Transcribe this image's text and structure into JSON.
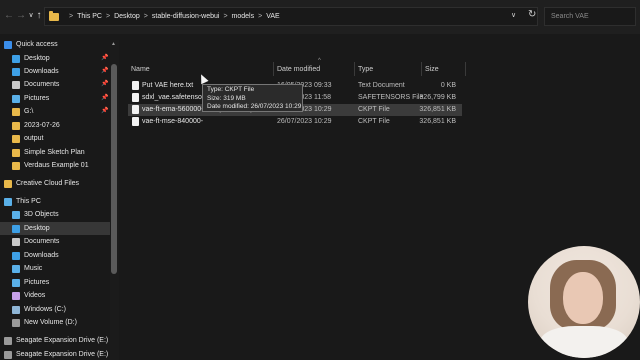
{
  "address_bar": {
    "back": "←",
    "forward": "→",
    "dropdown": "∨",
    "up": "↑",
    "crumbs": [
      "This PC",
      "Desktop",
      "stable-diffusion-webui",
      "models",
      "VAE"
    ],
    "crumb_sep": ">",
    "address_dropdown": "∨",
    "refresh": "↻",
    "search_placeholder": "Search VAE"
  },
  "sidebar": {
    "items": [
      {
        "label": "Quick access",
        "icon": "star-icon",
        "color": "#3b8eea",
        "pinned": false
      },
      {
        "label": "Desktop",
        "icon": "desktop-icon",
        "color": "#3ea0e6",
        "pinned": true
      },
      {
        "label": "Downloads",
        "icon": "download-icon",
        "color": "#3ea0e6",
        "pinned": true
      },
      {
        "label": "Documents",
        "icon": "document-icon",
        "color": "#c9c9c9",
        "pinned": true
      },
      {
        "label": "Pictures",
        "icon": "picture-icon",
        "color": "#5ab0e8",
        "pinned": true
      },
      {
        "label": "G:\\",
        "icon": "folder-icon",
        "color": "#e8b84a",
        "pinned": true
      },
      {
        "label": "2023-07-26",
        "icon": "folder-icon",
        "color": "#e8b84a",
        "pinned": false
      },
      {
        "label": "output",
        "icon": "folder-icon",
        "color": "#e8b84a",
        "pinned": false
      },
      {
        "label": "Simple Sketch Plan",
        "icon": "folder-icon",
        "color": "#e8b84a",
        "pinned": false
      },
      {
        "label": "Verdaus Example 01",
        "icon": "folder-icon",
        "color": "#e8b84a",
        "pinned": false
      },
      {
        "label": "Creative Cloud Files",
        "icon": "creative-cloud-icon",
        "color": "#e8b84a",
        "pinned": false
      },
      {
        "label": "This PC",
        "icon": "computer-icon",
        "color": "#5ab0e8",
        "pinned": false
      },
      {
        "label": "3D Objects",
        "icon": "cube-icon",
        "color": "#5ab0e8",
        "pinned": false
      },
      {
        "label": "Desktop",
        "icon": "desktop-icon",
        "color": "#3ea0e6",
        "pinned": false
      },
      {
        "label": "Documents",
        "icon": "document-icon",
        "color": "#c9c9c9",
        "pinned": false
      },
      {
        "label": "Downloads",
        "icon": "download-icon",
        "color": "#3ea0e6",
        "pinned": false
      },
      {
        "label": "Music",
        "icon": "music-icon",
        "color": "#5ab0e8",
        "pinned": false
      },
      {
        "label": "Pictures",
        "icon": "picture-icon",
        "color": "#5ab0e8",
        "pinned": false
      },
      {
        "label": "Videos",
        "icon": "video-icon",
        "color": "#c7a0e8",
        "pinned": false
      },
      {
        "label": "Windows (C:)",
        "icon": "drive-icon",
        "color": "#8fb6d6",
        "pinned": false
      },
      {
        "label": "New Volume (D:)",
        "icon": "drive-icon",
        "color": "#9a9a9a",
        "pinned": false
      },
      {
        "label": "Seagate Expansion Drive (E:)",
        "icon": "drive-icon",
        "color": "#9a9a9a",
        "pinned": false
      },
      {
        "label": "Seagate Expansion Drive (E:)",
        "icon": "drive-icon",
        "color": "#9a9a9a",
        "pinned": false
      }
    ],
    "pin_glyph": "📌",
    "selected_index": 13
  },
  "columns": {
    "name": "Name",
    "date": "Date modified",
    "type": "Type",
    "size": "Size"
  },
  "files": [
    {
      "name": "Put VAE here.txt",
      "date": "16/05/2023 09:33",
      "type": "Text Document",
      "size": "0 KB"
    },
    {
      "name": "sdxl_vae.safetensors",
      "date": "27/07/2023 11:58",
      "type": "SAFETENSORS File",
      "size": "326,799 KB"
    },
    {
      "name": "vae-ft-ema-560000-ema-pruned.ckpt",
      "date": "26/07/2023 10:29",
      "type": "CKPT File",
      "size": "326,851 KB"
    },
    {
      "name": "vae-ft-mse-840000-",
      "date": "26/07/2023 10:29",
      "type": "CKPT File",
      "size": "326,851 KB"
    }
  ],
  "selected_file_index": 2,
  "tooltip": {
    "type_line": "Type: CKPT File",
    "size_line": "Size: 319 MB",
    "date_line": "Date modified: 26/07/2023 10:29"
  }
}
